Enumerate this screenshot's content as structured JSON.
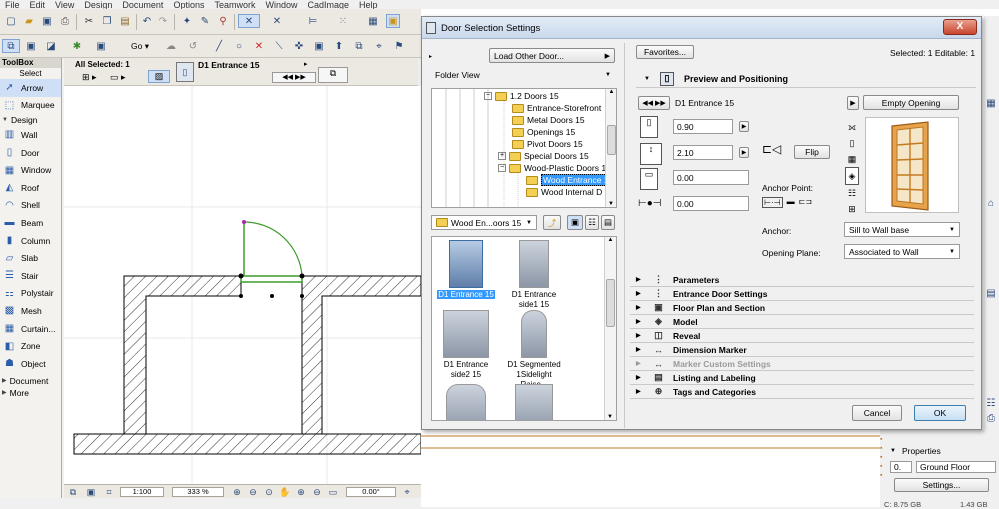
{
  "menu": [
    "File",
    "Edit",
    "View",
    "Design",
    "Document",
    "Options",
    "Teamwork",
    "Window",
    "CadImage",
    "Help"
  ],
  "toolbox": {
    "title": "ToolBox",
    "select_label": "Select",
    "tools_select": [
      {
        "label": "Arrow",
        "icon": "arrow-icon"
      },
      {
        "label": "Marquee",
        "icon": "marquee-icon"
      }
    ],
    "design_section": "Design",
    "tools_design": [
      {
        "label": "Wall",
        "icon": "wall-icon"
      },
      {
        "label": "Door",
        "icon": "door-icon"
      },
      {
        "label": "Window",
        "icon": "window-icon"
      },
      {
        "label": "Roof",
        "icon": "roof-icon"
      },
      {
        "label": "Shell",
        "icon": "shell-icon"
      },
      {
        "label": "Beam",
        "icon": "beam-icon"
      },
      {
        "label": "Column",
        "icon": "column-icon"
      },
      {
        "label": "Slab",
        "icon": "slab-icon"
      },
      {
        "label": "Stair",
        "icon": "stair-icon"
      },
      {
        "label": "Polystair",
        "icon": "polystair-icon"
      },
      {
        "label": "Mesh",
        "icon": "mesh-icon"
      },
      {
        "label": "Curtain...",
        "icon": "curtain-wall-icon"
      },
      {
        "label": "Zone",
        "icon": "zone-icon"
      },
      {
        "label": "Object",
        "icon": "object-icon"
      }
    ],
    "document_section": "Document",
    "more_section": "More"
  },
  "infobox": {
    "all_selected": "All Selected: 1",
    "element_name": "D1 Entrance 15"
  },
  "statusbar": {
    "scale": "1:100",
    "zoom": "333 %",
    "angle": "0.00°"
  },
  "dialog": {
    "title": "Door Selection Settings",
    "close": "X",
    "load_other": "Load Other Door...",
    "folder_view": "Folder View",
    "tree": [
      {
        "label": "1.2 Doors 15",
        "selected": false
      },
      {
        "label": "Entrance-Storefront",
        "selected": false
      },
      {
        "label": "Metal Doors 15",
        "selected": false
      },
      {
        "label": "Openings 15",
        "selected": false
      },
      {
        "label": "Pivot Doors 15",
        "selected": false
      },
      {
        "label": "Special Doors 15",
        "selected": false
      },
      {
        "label": "Wood-Plastic Doors 1",
        "selected": false
      },
      {
        "label": "Wood Entrance 1",
        "selected": true
      },
      {
        "label": "Wood Internal D",
        "selected": false
      }
    ],
    "folder_combo": "Wood En...oors 15",
    "thumbs": [
      {
        "label": "D1 Entrance 15",
        "selected": true
      },
      {
        "label": "D1 Entrance side1 15",
        "selected": false
      },
      {
        "label": "D1 Entrance side2 15",
        "selected": false
      },
      {
        "label": "D1 Segmented 1Sidelight Raise...",
        "selected": false
      },
      {
        "label": "",
        "selected": false
      },
      {
        "label": "",
        "selected": false
      }
    ],
    "favorites": "Favorites...",
    "selected_info": "Selected: 1 Editable: 1",
    "preview_header": "Preview and Positioning",
    "element_name": "D1 Entrance 15",
    "empty_opening": "Empty Opening",
    "width": "0.90",
    "height": "2.10",
    "sill": "0.00",
    "offset": "0.00",
    "flip": "Flip",
    "anchor_point": "Anchor Point:",
    "anchor_label": "Anchor:",
    "anchor_value": "Sill to Wall base",
    "plane_label": "Opening Plane:",
    "plane_value": "Associated to Wall",
    "sections": [
      {
        "label": "Parameters",
        "icon": "parameters-icon",
        "disabled": false
      },
      {
        "label": "Entrance Door Settings",
        "icon": "settings-icon",
        "disabled": false
      },
      {
        "label": "Floor Plan and Section",
        "icon": "floor-plan-icon",
        "disabled": false
      },
      {
        "label": "Model",
        "icon": "model-icon",
        "disabled": false
      },
      {
        "label": "Reveal",
        "icon": "reveal-icon",
        "disabled": false
      },
      {
        "label": "Dimension Marker",
        "icon": "dimension-icon",
        "disabled": false
      },
      {
        "label": "Marker Custom Settings",
        "icon": "marker-icon",
        "disabled": true
      },
      {
        "label": "Listing and Labeling",
        "icon": "listing-icon",
        "disabled": false
      },
      {
        "label": "Tags and Categories",
        "icon": "tags-icon",
        "disabled": false
      }
    ],
    "cancel": "Cancel",
    "ok": "OK"
  },
  "rightpanel": {
    "properties": "Properties",
    "floor_num": "0.",
    "floor_name": "Ground Floor",
    "settings": "Settings...",
    "disk1": "C: 8.75 GB",
    "disk2": "1.43 GB"
  },
  "colors": {
    "selection": "#cfe0f6",
    "door_arc": "#3f9a2a",
    "tree_selection": "#3399ff"
  }
}
